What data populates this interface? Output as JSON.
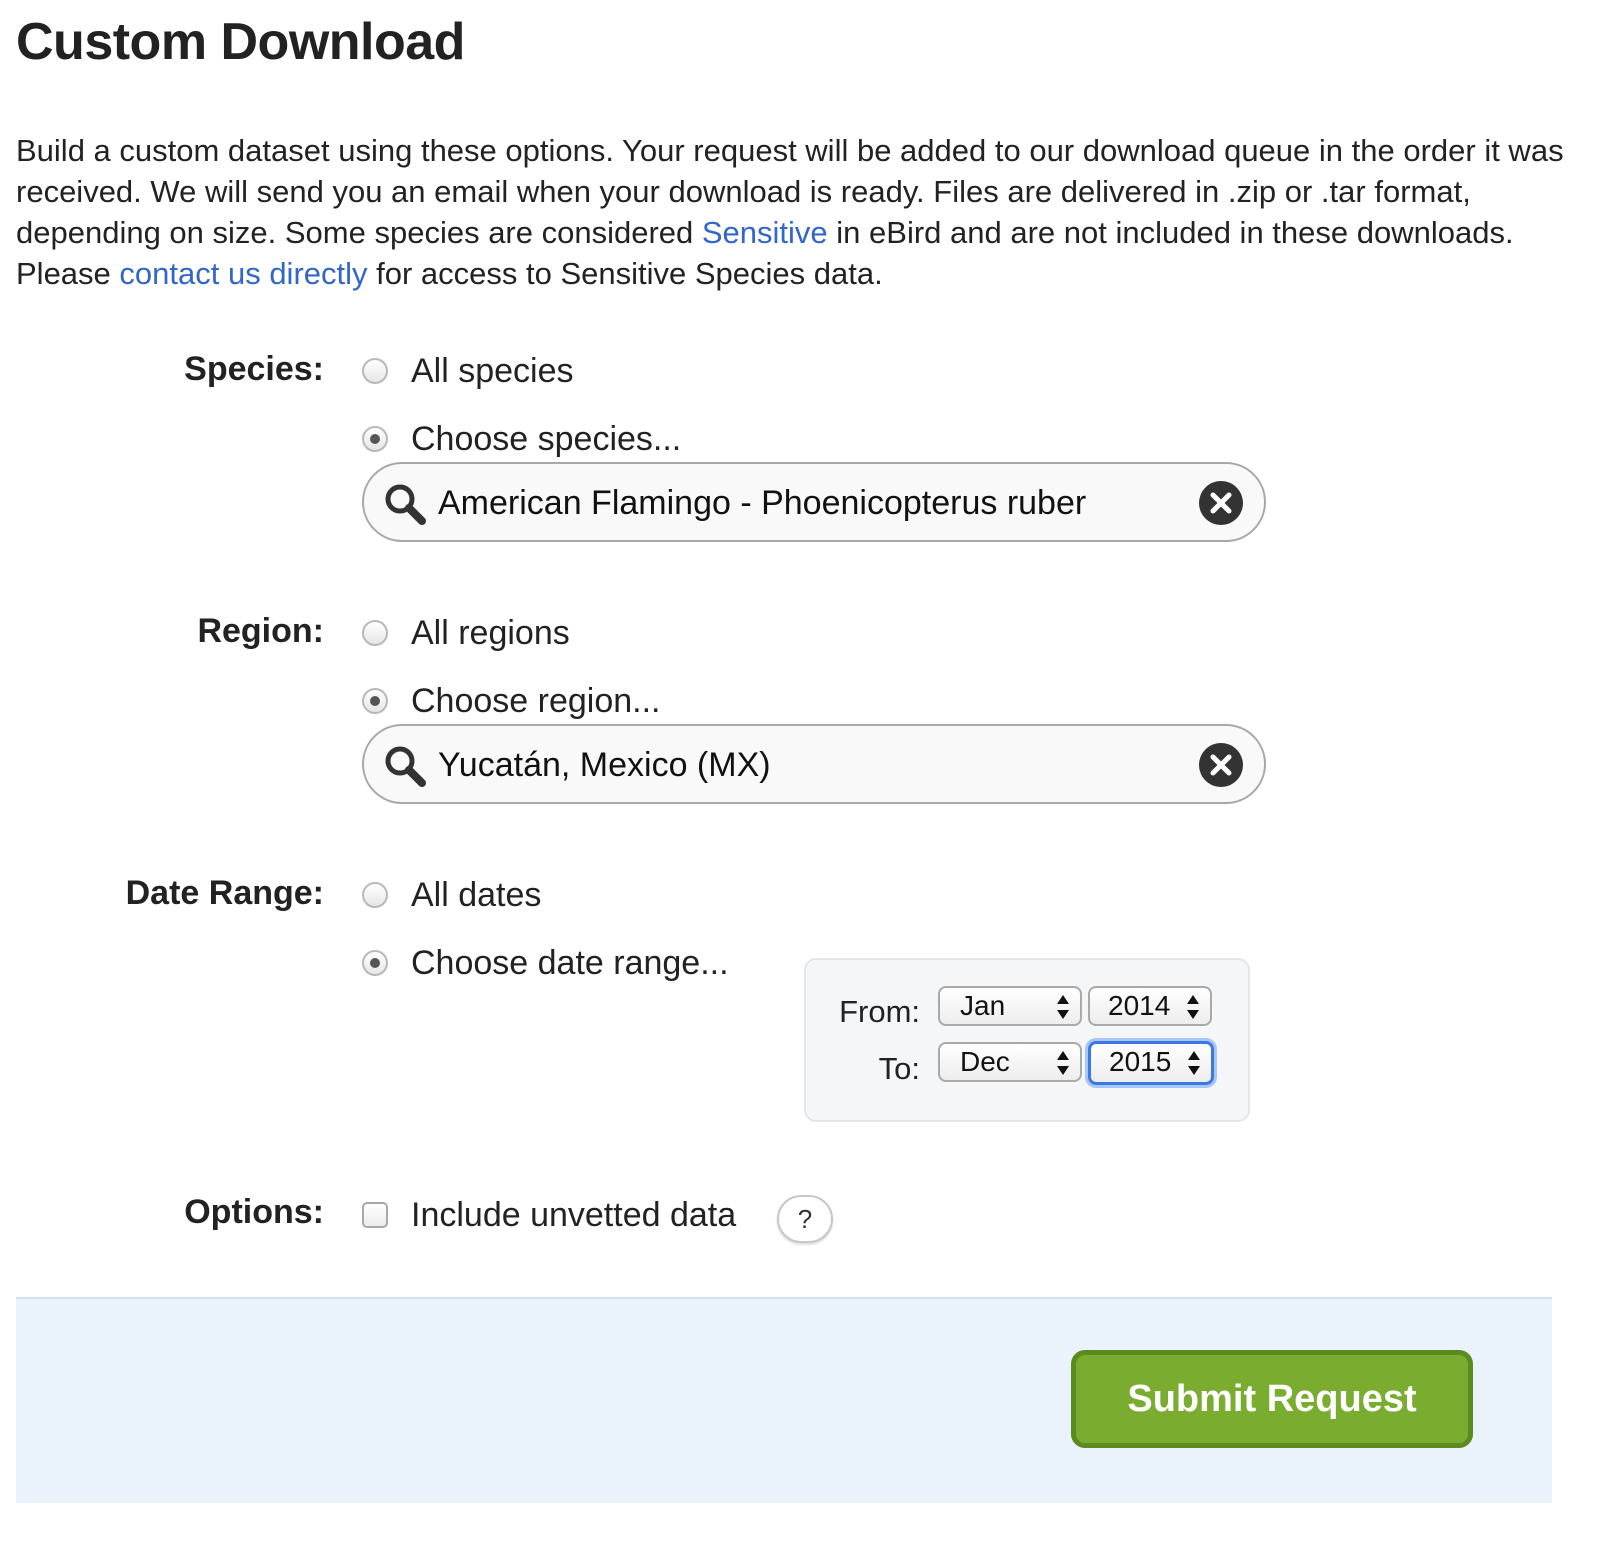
{
  "page": {
    "title": "Custom Download",
    "intro": {
      "part1": "Build a custom dataset using these options. Your request will be added to our download queue in the order it was received. We will send you an email when your download is ready. Files are delivered in .zip or .tar format, depending on size. Some species are considered ",
      "sensitive_link": "Sensitive",
      "part2": " in eBird and are not included in these downloads. Please ",
      "contact_link": "contact us directly",
      "part3": " for access to Sensitive Species data."
    }
  },
  "species": {
    "label": "Species:",
    "option_all": "All species",
    "option_choose": "Choose species...",
    "selected": "choose",
    "search_value": "American Flamingo - Phoenicopterus ruber"
  },
  "region": {
    "label": "Region:",
    "option_all": "All regions",
    "option_choose": "Choose region...",
    "selected": "choose",
    "search_value": "Yucatán, Mexico (MX)"
  },
  "date_range": {
    "label": "Date Range:",
    "option_all": "All dates",
    "option_choose": "Choose date range...",
    "selected": "choose",
    "from_label": "From:",
    "to_label": "To:",
    "from_month": "Jan",
    "from_year": "2014",
    "to_month": "Dec",
    "to_year": "2015"
  },
  "options": {
    "label": "Options:",
    "unvetted_label": "Include unvetted data",
    "unvetted_checked": false,
    "help": "?"
  },
  "footer": {
    "submit_label": "Submit Request",
    "submit_color": "#7aac2f"
  },
  "colors": {
    "link": "#3366cc",
    "footer_bg": "#eaf2fb",
    "focus": "#3b78e7"
  },
  "icons": {
    "search": "search-icon",
    "clear": "clear-icon",
    "select_arrows": "select-arrows-icon"
  }
}
